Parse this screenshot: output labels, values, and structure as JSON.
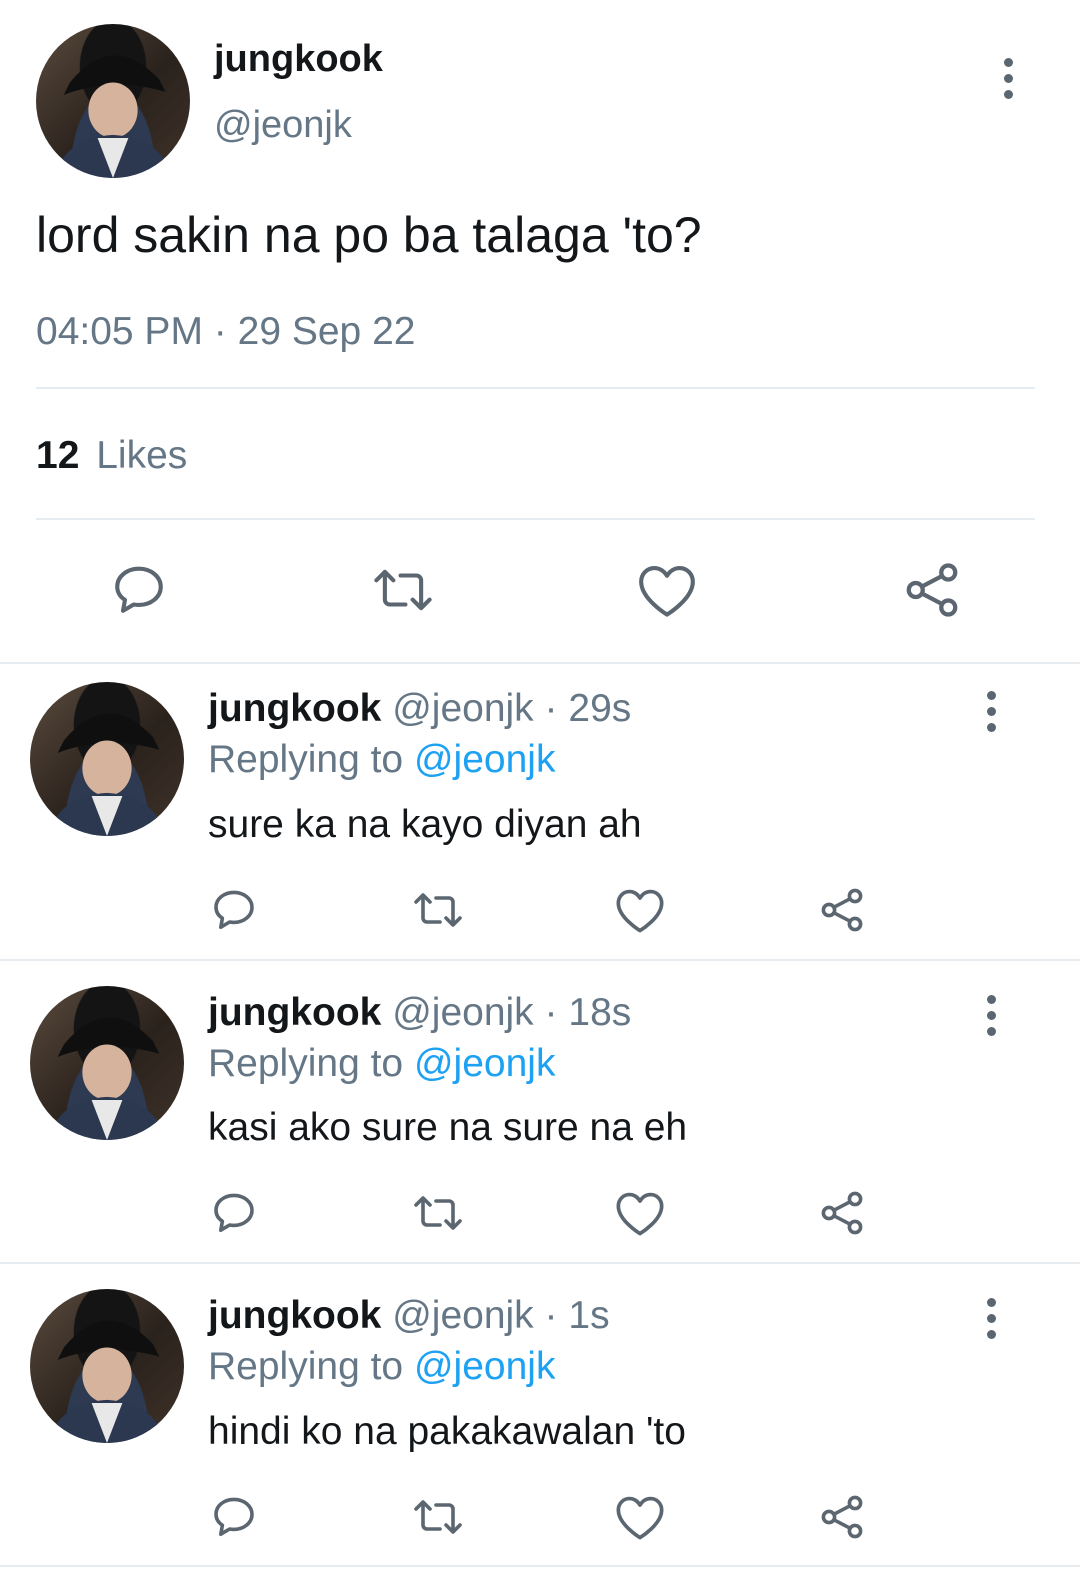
{
  "main_tweet": {
    "display_name": "jungkook",
    "handle": "@jeonjk",
    "text": "lord sakin na po ba talaga 'to?",
    "time": "04:05 PM",
    "separator": "·",
    "date": "29 Sep 22",
    "likes_count": "12",
    "likes_label": "Likes"
  },
  "icons": {
    "reply": "reply-icon",
    "retweet": "retweet-icon",
    "like": "heart-icon",
    "share": "share-icon",
    "more": "more-vertical-icon"
  },
  "replies": [
    {
      "display_name": "jungkook",
      "handle": "@jeonjk",
      "dot": "·",
      "time": "29s",
      "replying_label": "Replying to",
      "replying_handle": "@jeonjk",
      "text": "sure ka na kayo diyan ah"
    },
    {
      "display_name": "jungkook",
      "handle": "@jeonjk",
      "dot": "·",
      "time": "18s",
      "replying_label": "Replying to",
      "replying_handle": "@jeonjk",
      "text": "kasi ako sure na sure na eh"
    },
    {
      "display_name": "jungkook",
      "handle": "@jeonjk",
      "dot": "·",
      "time": "1s",
      "replying_label": "Replying to",
      "replying_handle": "@jeonjk",
      "text": "hindi ko na pakakawalan 'to"
    }
  ],
  "colors": {
    "text": "#14171a",
    "secondary": "#657786",
    "link": "#1da1f2",
    "divider": "#e6ecf0",
    "icon": "#5b6670"
  }
}
